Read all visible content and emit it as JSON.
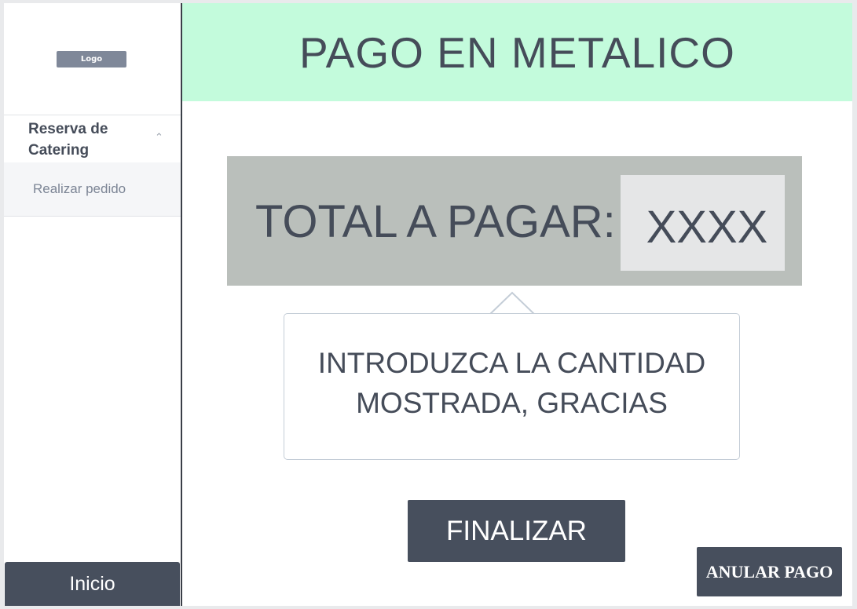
{
  "sidebar": {
    "logo_text": "Logo",
    "group_label": "Reserva de Catering",
    "group_chevron_icon": "chevron-up-icon",
    "items": [
      {
        "label": "Realizar pedido"
      }
    ],
    "home_button_label": "Inicio"
  },
  "header": {
    "title": "PAGO EN METALICO",
    "background_color": "#c3fbdc"
  },
  "payment": {
    "total_label": "TOTAL A PAGAR:",
    "total_value": "XXXX",
    "instruction": "INTRODUZCA LA CANTIDAD MOSTRADA, GRACIAS"
  },
  "actions": {
    "finish_label": "FINALIZAR",
    "cancel_label": "ANULAR PAGO",
    "button_color": "#474f5d"
  }
}
